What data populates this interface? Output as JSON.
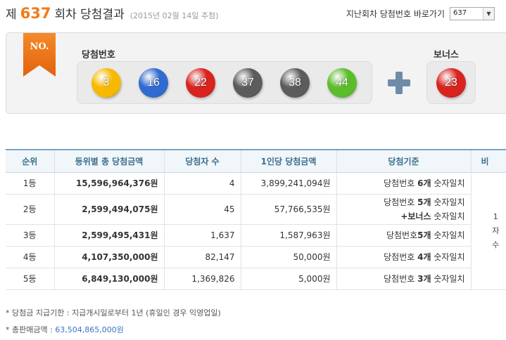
{
  "header": {
    "title_prefix": "제",
    "round_no": "637",
    "title_suffix": "회차 당첨결과",
    "draw_date": "(2015년 02월 14일 추첨)",
    "jump_label": "지난회차 당첨번호 바로가기",
    "jump_select_value": "637"
  },
  "panel": {
    "badge": "NO.",
    "winning_label": "당첨번호",
    "bonus_label": "보너스",
    "numbers": [
      "3",
      "16",
      "22",
      "37",
      "38",
      "44"
    ],
    "bonus": "23",
    "ball_colors": {
      "yellow": "#f7b900",
      "blue": "#2f6bd0",
      "red": "#d8231f",
      "gray": "#5c5c5c",
      "green": "#5bbd2a"
    },
    "plus_icon": "plus-icon"
  },
  "table": {
    "headers": [
      "순위",
      "등위별 총 당첨금액",
      "당첨자 수",
      "1인당 당첨금액",
      "당첨기준",
      "비"
    ],
    "rows": [
      {
        "rank": "1등",
        "total": "15,596,964,376원",
        "winners": "4",
        "per_person": "3,899,241,094원",
        "criteria": [
          "당첨번호 ",
          "6개",
          " 숫자일치"
        ]
      },
      {
        "rank": "2등",
        "total": "2,599,494,075원",
        "winners": "45",
        "per_person": "57,766,535원",
        "criteria": [
          "당첨번호 ",
          "5개",
          " 숫자일치"
        ],
        "criteria2": [
          "+",
          "보너스",
          " 숫자일치"
        ]
      },
      {
        "rank": "3등",
        "total": "2,599,495,431원",
        "winners": "1,637",
        "per_person": "1,587,963원",
        "criteria": [
          "당첨번호",
          "5개",
          " 숫자일치"
        ]
      },
      {
        "rank": "4등",
        "total": "4,107,350,000원",
        "winners": "82,147",
        "per_person": "50,000원",
        "criteria": [
          "당첨번호 ",
          "4개",
          " 숫자일치"
        ]
      },
      {
        "rank": "5등",
        "total": "6,849,130,000원",
        "winners": "1,369,826",
        "per_person": "5,000원",
        "criteria": [
          "당첨번호 ",
          "3개",
          " 숫자일치"
        ]
      }
    ],
    "extra_col_text": [
      "1",
      "자",
      "수"
    ]
  },
  "notes": {
    "deadline": "* 당첨금 지급기한 : 지급개시일로부터 1년 (휴일인 경우 익영업일)",
    "sales_label": "* 총판매금액 : ",
    "sales_amount": "63,504,865,000원"
  }
}
